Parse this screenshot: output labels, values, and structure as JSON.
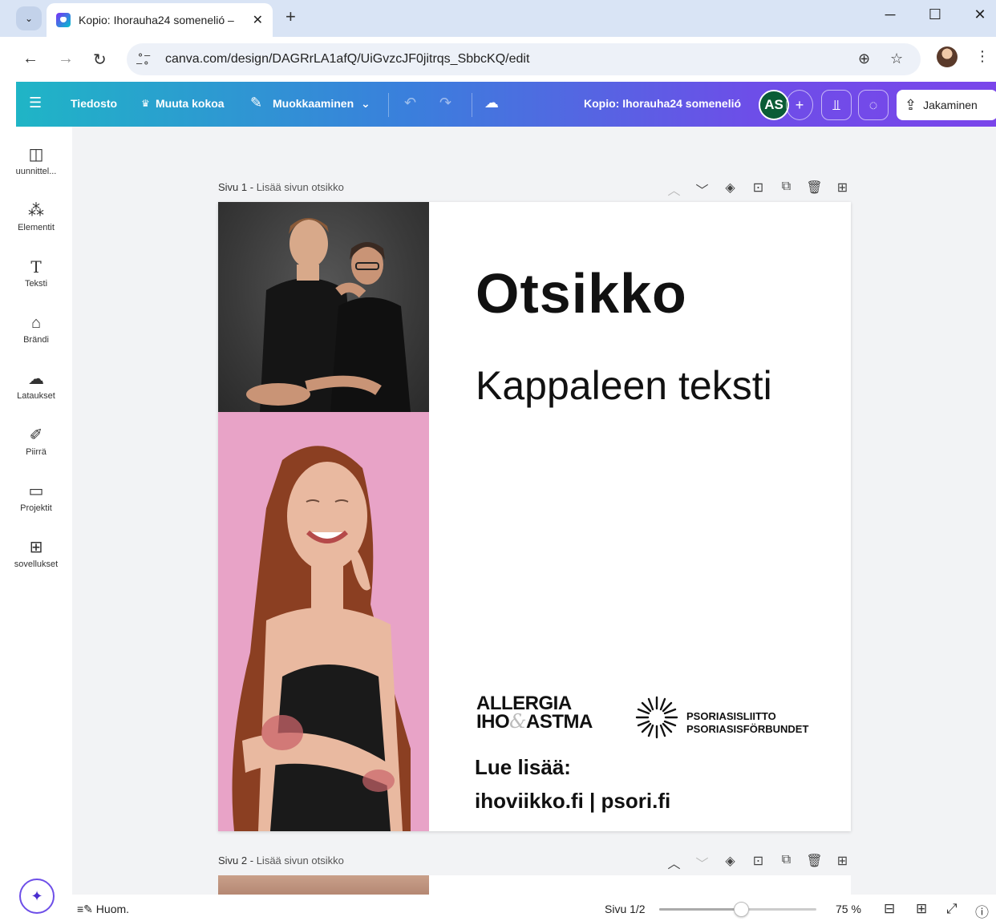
{
  "browser": {
    "tab_title": "Kopio: Ihorauha24 somenelió –",
    "tab_close": "✕",
    "new_tab": "+",
    "url": "canva.com/design/DAGRrLA1afQ/UiGvzcJF0jitrqs_SbbcKQ/edit"
  },
  "canva_header": {
    "menu_file": "Tiedosto",
    "resize": "Muuta kokoa",
    "editing": "Muokkaaminen",
    "design_title": "Kopio: Ihorauha24 somenelió",
    "avatar_initials": "AS",
    "share": "Jakaminen"
  },
  "sidebar": {
    "items": [
      {
        "label": "uunnittel...",
        "icon": "design-icon"
      },
      {
        "label": "Elementit",
        "icon": "elements-icon"
      },
      {
        "label": "Teksti",
        "icon": "text-icon"
      },
      {
        "label": "Brändi",
        "icon": "brand-icon"
      },
      {
        "label": "Lataukset",
        "icon": "uploads-icon"
      },
      {
        "label": "Piirrä",
        "icon": "draw-icon"
      },
      {
        "label": "Projektit",
        "icon": "projects-icon"
      },
      {
        "label": "sovellukset",
        "icon": "apps-icon"
      }
    ]
  },
  "pages": [
    {
      "label": "Sivu 1",
      "subtitle": "Lisää sivun otsikko"
    },
    {
      "label": "Sivu 2",
      "subtitle": "Lisää sivun otsikko"
    }
  ],
  "design": {
    "headline": "Otsikko",
    "body": "Kappaleen teksti",
    "logo1_line1": "ALLERGIA",
    "logo1_line2a": "IHO",
    "logo1_amp": "&",
    "logo1_line2b": "ASTMA",
    "logo2_line1": "PSORIASISLIITTO",
    "logo2_line2": "PSORIASISFÖRBUNDET",
    "read_more": "Lue lisää:",
    "links": "ihoviikko.fi | psori.fi"
  },
  "bottom_bar": {
    "notes": "Huom.",
    "page_indicator": "Sivu 1/2",
    "zoom": "75 %",
    "zoom_fraction": 0.52
  },
  "colors": {
    "accent_start": "#1fb5c6",
    "accent_end": "#7a45ea",
    "avatar": "#0a5c36",
    "pink_bg": "#e8a3c7"
  }
}
